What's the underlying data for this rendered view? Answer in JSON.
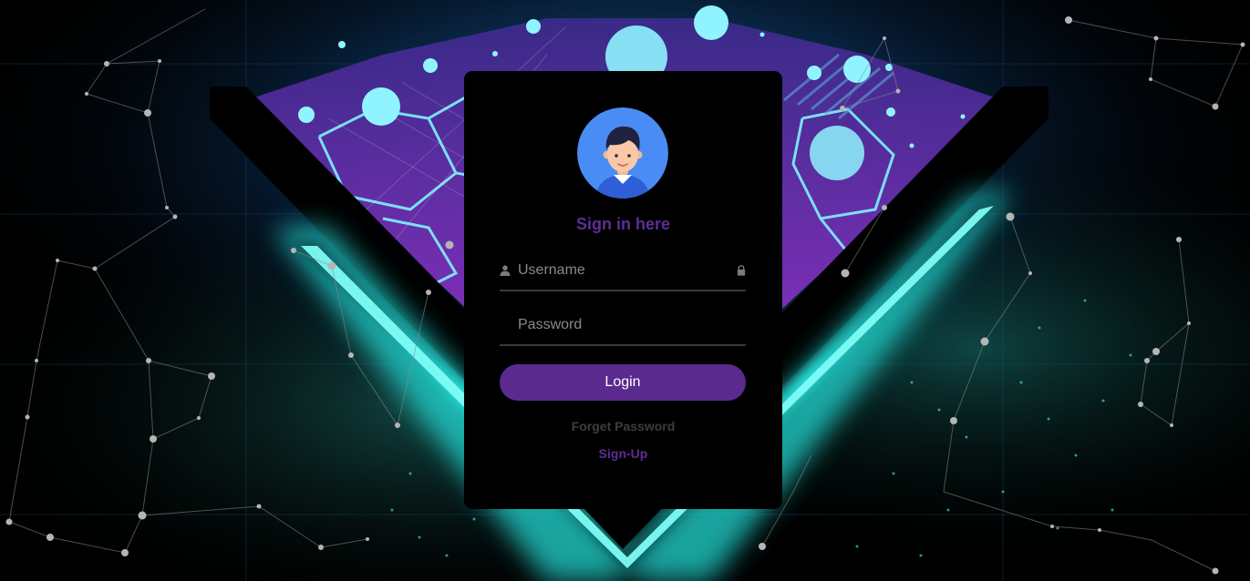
{
  "login_form": {
    "title": "Sign in here",
    "username_placeholder": "Username",
    "password_placeholder": "Password",
    "login_label": "Login",
    "forgot_label": "Forget Password",
    "signup_label": "Sign-Up"
  },
  "icons": {
    "avatar": "user-avatar-icon",
    "username": "user-icon",
    "password": "lock-icon"
  },
  "colors": {
    "accent": "#5b2a8f",
    "title": "#5f2d96",
    "cyan_glow": "#2ee8e0",
    "card_background": "#000000",
    "avatar_background": "#4a8cf5"
  }
}
